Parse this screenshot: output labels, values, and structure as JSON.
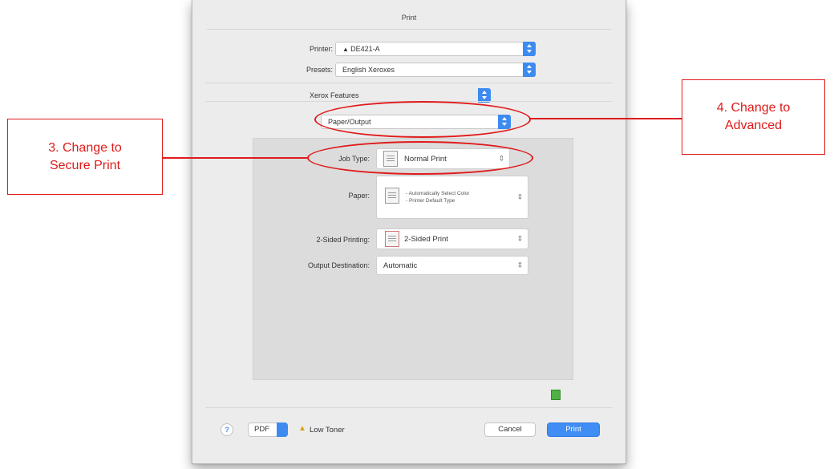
{
  "dialog": {
    "title": "Print",
    "printer_label": "Printer:",
    "printer_value": "DE421-A",
    "presets_label": "Presets:",
    "presets_value": "English Xeroxes",
    "features_value": "Xerox Features",
    "section_value": "Paper/Output"
  },
  "panel": {
    "job_type_label": "Job Type:",
    "job_type_value": "Normal Print",
    "paper_label": "Paper:",
    "paper_line1": "- Automatically Select Color",
    "paper_line2": "- Printer Default Type",
    "sided_label": "2-Sided Printing:",
    "sided_value": "2-Sided Print",
    "output_label": "Output Destination:",
    "output_value": "Automatic"
  },
  "footer": {
    "help_label": "?",
    "pdf_label": "PDF",
    "toner_status": "Low Toner",
    "cancel_label": "Cancel",
    "print_label": "Print"
  },
  "annotations": {
    "callout_left": "3. Change to Secure Print",
    "callout_right": "4. Change to Advanced"
  },
  "colors": {
    "accent": "#3d8bf0",
    "annotation": "#e01b1b"
  }
}
